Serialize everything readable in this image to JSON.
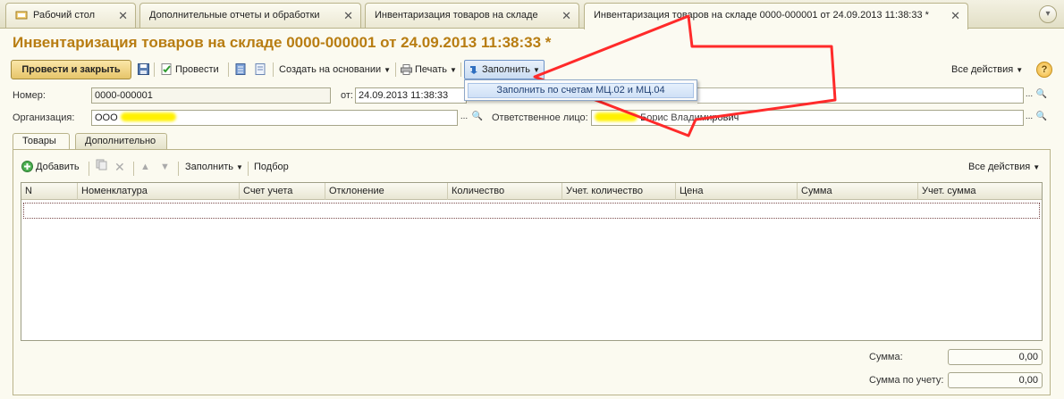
{
  "tabs": [
    {
      "label": "Рабочий стол"
    },
    {
      "label": "Дополнительные отчеты и обработки"
    },
    {
      "label": "Инвентаризация товаров на складе"
    },
    {
      "label": "Инвентаризация товаров на складе 0000-000001 от 24.09.2013 11:38:33 *"
    }
  ],
  "document": {
    "title": "Инвентаризация товаров на складе 0000-000001 от 24.09.2013 11:38:33 *"
  },
  "toolbar": {
    "post_close": "Провести и закрыть",
    "post": "Провести",
    "create_based": "Создать на основании",
    "print": "Печать",
    "fill": "Заполнить",
    "all_actions": "Все действия",
    "help": "?"
  },
  "fill_menu": {
    "item": "Заполнить по счетам МЦ.02 и МЦ.04"
  },
  "form": {
    "number_label": "Номер:",
    "number_value": "0000-000001",
    "date_label": "от:",
    "date_value": "24.09.2013 11:38:33",
    "org_label": "Организация:",
    "org_prefix": "ООО",
    "resp_label": "Ответственное лицо:",
    "resp_value": "Борис Владимирович"
  },
  "inner_tabs": {
    "goods": "Товары",
    "extra": "Дополнительно"
  },
  "table_toolbar": {
    "add": "Добавить",
    "fill": "Заполнить",
    "selection": "Подбор",
    "all_actions": "Все действия"
  },
  "table": {
    "columns": [
      "N",
      "Номенклатура",
      "Счет учета",
      "Отклонение",
      "Количество",
      "Учет. количество",
      "Цена",
      "Сумма",
      "Учет. сумма"
    ]
  },
  "totals": {
    "sum_label": "Сумма:",
    "sum_value": "0,00",
    "acc_sum_label": "Сумма по учету:",
    "acc_sum_value": "0,00"
  }
}
